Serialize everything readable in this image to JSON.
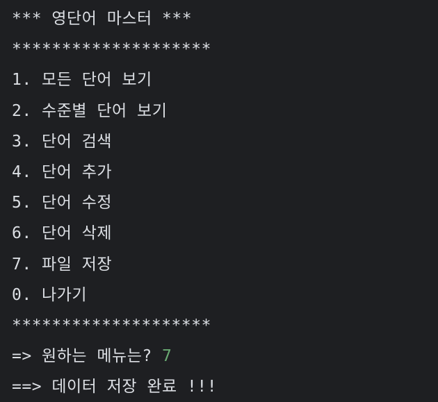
{
  "terminal": {
    "lines": [
      "*** 영단어 마스터 ***",
      "********************",
      "1. 모든 단어 보기",
      "2. 수준별 단어 보기",
      "3. 단어 검색",
      "4. 단어 추가",
      "5. 단어 수정",
      "6. 단어 삭제",
      "7. 파일 저장",
      "0. 나가기",
      "********************"
    ],
    "prompt": "=> 원하는 메뉴는? ",
    "user_input": "7",
    "result": "==> 데이터 저장 완료 !!!"
  },
  "colors": {
    "background": "#1e1f22",
    "text": "#dcdfe4",
    "user_input": "#6aab73"
  }
}
